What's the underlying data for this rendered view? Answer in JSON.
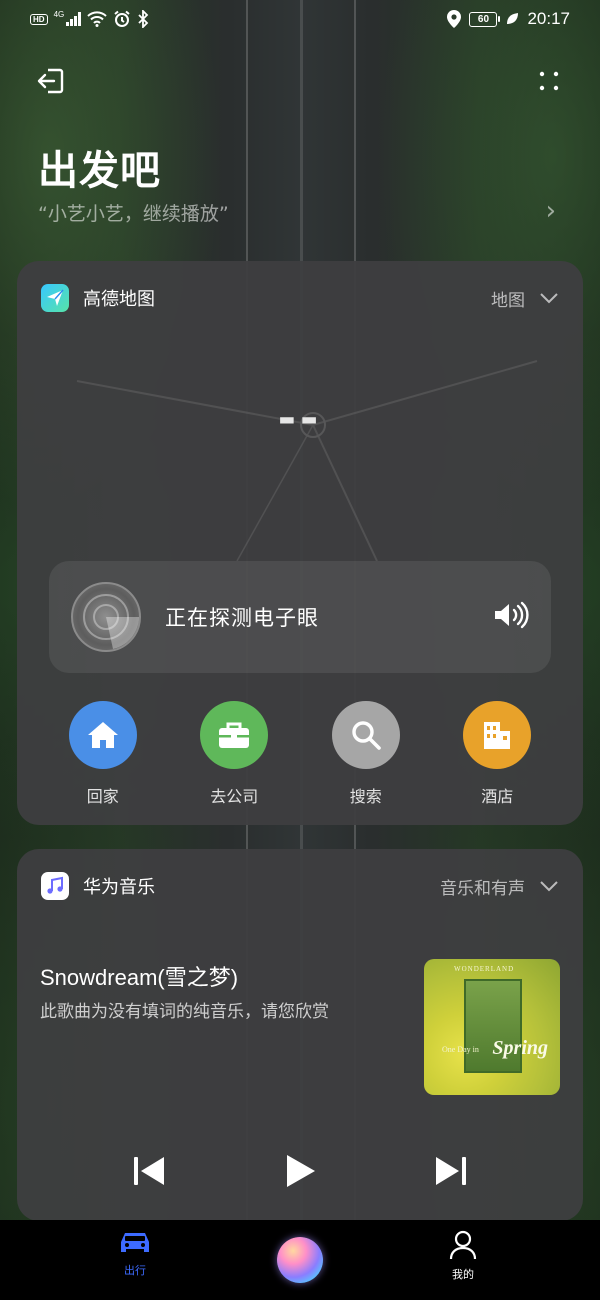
{
  "status": {
    "network": "4G",
    "battery": "60",
    "time": "20:17"
  },
  "header": {
    "title": "出发吧",
    "subtitle": "“小艺小艺，继续播放”"
  },
  "map_card": {
    "app_name": "高德地图",
    "category": "地图",
    "speed_display": "--",
    "detect_text": "正在探测电子眼",
    "quick_actions": [
      {
        "label": "回家",
        "color": "#4a8fe7",
        "icon": "home-icon"
      },
      {
        "label": "去公司",
        "color": "#5fb85a",
        "icon": "briefcase-icon"
      },
      {
        "label": "搜索",
        "color": "#a6a6a6",
        "icon": "search-icon"
      },
      {
        "label": "酒店",
        "color": "#e8a22a",
        "icon": "hotel-icon"
      }
    ]
  },
  "music_card": {
    "app_name": "华为音乐",
    "category": "音乐和有声",
    "song_title": "Snowdream(雪之梦)",
    "song_subtitle": "此歌曲为没有填词的纯音乐，请您欣赏",
    "album_top": "WONDERLAND",
    "album_text_small": "One Day in",
    "album_text_big": "Spring"
  },
  "bottom_nav": {
    "items": [
      {
        "label": "出行",
        "active": true,
        "color": "#3d6bff"
      },
      {
        "label": "我的",
        "active": false,
        "color": "#ffffff"
      }
    ]
  }
}
